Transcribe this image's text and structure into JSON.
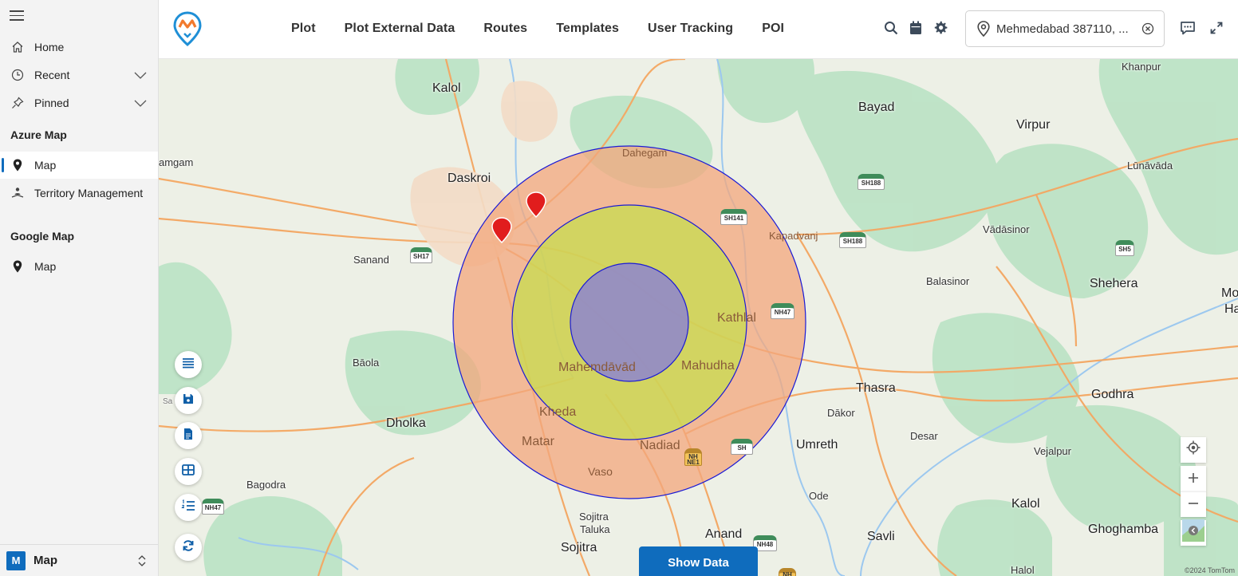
{
  "sidebar": {
    "items_top": [
      {
        "label": "Home",
        "icon": "home-icon"
      },
      {
        "label": "Recent",
        "icon": "clock-icon"
      },
      {
        "label": "Pinned",
        "icon": "pin-icon"
      }
    ],
    "sections": [
      {
        "title": "Azure Map",
        "items": [
          {
            "label": "Map",
            "icon": "map-pin-icon",
            "active": true
          },
          {
            "label": "Territory Management",
            "icon": "territory-icon"
          }
        ]
      },
      {
        "title": "Google Map",
        "items": [
          {
            "label": "Map",
            "icon": "map-pin-icon"
          }
        ]
      }
    ],
    "footer": {
      "badge": "M",
      "label": "Map"
    }
  },
  "topbar": {
    "nav": [
      "Plot",
      "Plot External Data",
      "Routes",
      "Templates",
      "User Tracking",
      "POI"
    ],
    "location_value": "Mehmedabad 387110, ..."
  },
  "map": {
    "labels": [
      {
        "text": "Kalol"
      },
      {
        "text": "Bayad"
      },
      {
        "text": "Khanpur"
      },
      {
        "text": "Virpur"
      },
      {
        "text": "Dahegam"
      },
      {
        "text": "Lūnāvāda"
      },
      {
        "text": "amgam"
      },
      {
        "text": "Daskroi"
      },
      {
        "text": "Kapadvanj"
      },
      {
        "text": "Vādāsinor"
      },
      {
        "text": "Sanand"
      },
      {
        "text": "Balasinor"
      },
      {
        "text": "Shehera"
      },
      {
        "text": "Mo"
      },
      {
        "text": "Ha"
      },
      {
        "text": "Kathlal"
      },
      {
        "text": "Bāola"
      },
      {
        "text": "Mahemdāvād"
      },
      {
        "text": "Mahudha"
      },
      {
        "text": "Thasra"
      },
      {
        "text": "Godhra"
      },
      {
        "text": "Sa"
      },
      {
        "text": "Dholka"
      },
      {
        "text": "Kheda"
      },
      {
        "text": "Dākor"
      },
      {
        "text": "Matar"
      },
      {
        "text": "Nadiad"
      },
      {
        "text": "Umreth"
      },
      {
        "text": "Desar"
      },
      {
        "text": "Vejalpur"
      },
      {
        "text": "Vaso"
      },
      {
        "text": "Bagodra"
      },
      {
        "text": "Ode"
      },
      {
        "text": "Kalol"
      },
      {
        "text": "Sojitra"
      },
      {
        "text": "Taluka"
      },
      {
        "text": "Anand"
      },
      {
        "text": "Savli"
      },
      {
        "text": "Ghoghamba"
      },
      {
        "text": "Sojitra"
      },
      {
        "text": "Halol"
      }
    ],
    "shields": [
      "SH188",
      "SH141",
      "SH188",
      "SH5",
      "SH17",
      "NH47",
      "SH",
      "NH NE1",
      "NH47",
      "NH48",
      "NH"
    ],
    "show_data_label": "Show Data",
    "attribution": "©2024 TomTom",
    "colors": {
      "outer_ring": "#f3a77c",
      "middle_ring": "#c4e04a",
      "inner_ring": "#8a7fd6",
      "ring_stroke": "#1a1ad6",
      "marker": "#e11d1d",
      "accent": "#0f6cbd"
    }
  }
}
